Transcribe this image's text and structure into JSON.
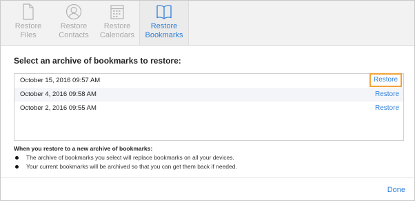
{
  "toolbar": {
    "items": [
      {
        "line1": "Restore",
        "line2": "Files",
        "icon": "document-icon"
      },
      {
        "line1": "Restore",
        "line2": "Contacts",
        "icon": "person-icon"
      },
      {
        "line1": "Restore",
        "line2": "Calendars",
        "icon": "calendar-icon"
      },
      {
        "line1": "Restore",
        "line2": "Bookmarks",
        "icon": "book-icon"
      }
    ],
    "active_index": 3,
    "active_color": "#2f7fd8"
  },
  "main": {
    "heading": "Select an archive of bookmarks to restore:",
    "archives": [
      {
        "date": "October 15, 2016 09:57 AM",
        "action": "Restore"
      },
      {
        "date": "October 4, 2016 09:58 AM",
        "action": "Restore"
      },
      {
        "date": "October 2, 2016 09:55 AM",
        "action": "Restore"
      }
    ],
    "highlight_color": "#f2a33a"
  },
  "info": {
    "title": "When you restore to a new archive of bookmarks:",
    "bullets": [
      "The archive of bookmarks you select will replace bookmarks on all your devices.",
      "Your current bookmarks will be archived so that you can get them back if needed."
    ]
  },
  "footer": {
    "done_label": "Done"
  }
}
